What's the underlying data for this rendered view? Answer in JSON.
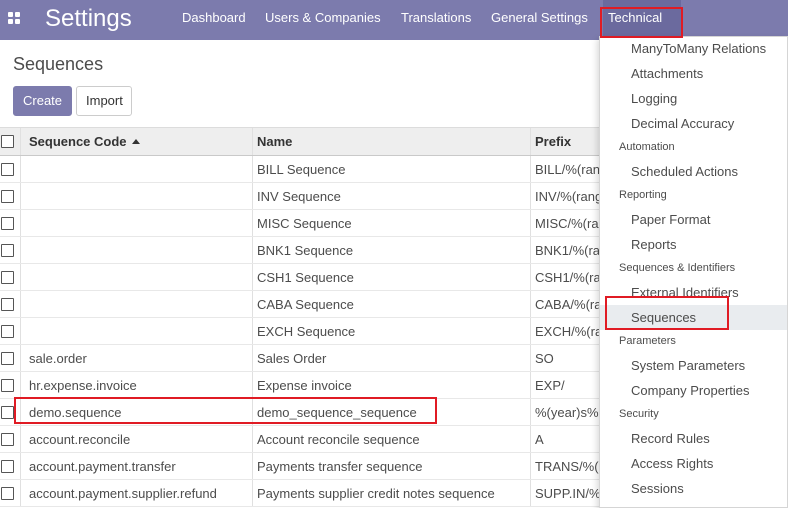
{
  "navbar": {
    "brand": "Settings",
    "menus": [
      "Dashboard",
      "Users & Companies",
      "Translations",
      "General Settings",
      "Technical"
    ],
    "accent_color": "#7c7bad"
  },
  "page": {
    "breadcrumb": "Sequences",
    "create_label": "Create",
    "import_label": "Import"
  },
  "table": {
    "headers": {
      "code": "Sequence Code",
      "name": "Name",
      "prefix": "Prefix"
    },
    "rows": [
      {
        "code": "",
        "name": "BILL Sequence",
        "prefix": "BILL/%(range_year)s/"
      },
      {
        "code": "",
        "name": "INV Sequence",
        "prefix": "INV/%(range_year)s/"
      },
      {
        "code": "",
        "name": "MISC Sequence",
        "prefix": "MISC/%(range_year)s/"
      },
      {
        "code": "",
        "name": "BNK1 Sequence",
        "prefix": "BNK1/%(range_year)s/"
      },
      {
        "code": "",
        "name": "CSH1 Sequence",
        "prefix": "CSH1/%(range_year)s/"
      },
      {
        "code": "",
        "name": "CABA Sequence",
        "prefix": "CABA/%(range_year)s/"
      },
      {
        "code": "",
        "name": "EXCH Sequence",
        "prefix": "EXCH/%(range_year)s/"
      },
      {
        "code": "sale.order",
        "name": "Sales Order",
        "prefix": "SO"
      },
      {
        "code": "hr.expense.invoice",
        "name": "Expense invoice",
        "prefix": "EXP/"
      },
      {
        "code": "demo.sequence",
        "name": "demo_sequence_sequence",
        "prefix": "%(year)s%(month)s"
      },
      {
        "code": "account.reconcile",
        "name": "Account reconcile sequence",
        "prefix": "A"
      },
      {
        "code": "account.payment.transfer",
        "name": "Payments transfer sequence",
        "prefix": "TRANS/%(range_year)s/"
      },
      {
        "code": "account.payment.supplier.refund",
        "name": "Payments supplier credit notes sequence",
        "prefix": "SUPP.IN/%(range_year)s/"
      }
    ]
  },
  "technical_menu": {
    "entries": [
      {
        "kind": "item",
        "label": "ManyToMany Relations"
      },
      {
        "kind": "item",
        "label": "Attachments"
      },
      {
        "kind": "item",
        "label": "Logging"
      },
      {
        "kind": "item",
        "label": "Decimal Accuracy"
      },
      {
        "kind": "header",
        "label": "Automation"
      },
      {
        "kind": "item",
        "label": "Scheduled Actions"
      },
      {
        "kind": "header",
        "label": "Reporting"
      },
      {
        "kind": "item",
        "label": "Paper Format"
      },
      {
        "kind": "item",
        "label": "Reports"
      },
      {
        "kind": "header",
        "label": "Sequences & Identifiers"
      },
      {
        "kind": "item",
        "label": "External Identifiers"
      },
      {
        "kind": "item",
        "label": "Sequences",
        "active": true
      },
      {
        "kind": "header",
        "label": "Parameters"
      },
      {
        "kind": "item",
        "label": "System Parameters"
      },
      {
        "kind": "item",
        "label": "Company Properties"
      },
      {
        "kind": "header",
        "label": "Security"
      },
      {
        "kind": "item",
        "label": "Record Rules"
      },
      {
        "kind": "item",
        "label": "Access Rights"
      },
      {
        "kind": "item",
        "label": "Sessions"
      }
    ]
  },
  "highlight_color": "#e01b24"
}
